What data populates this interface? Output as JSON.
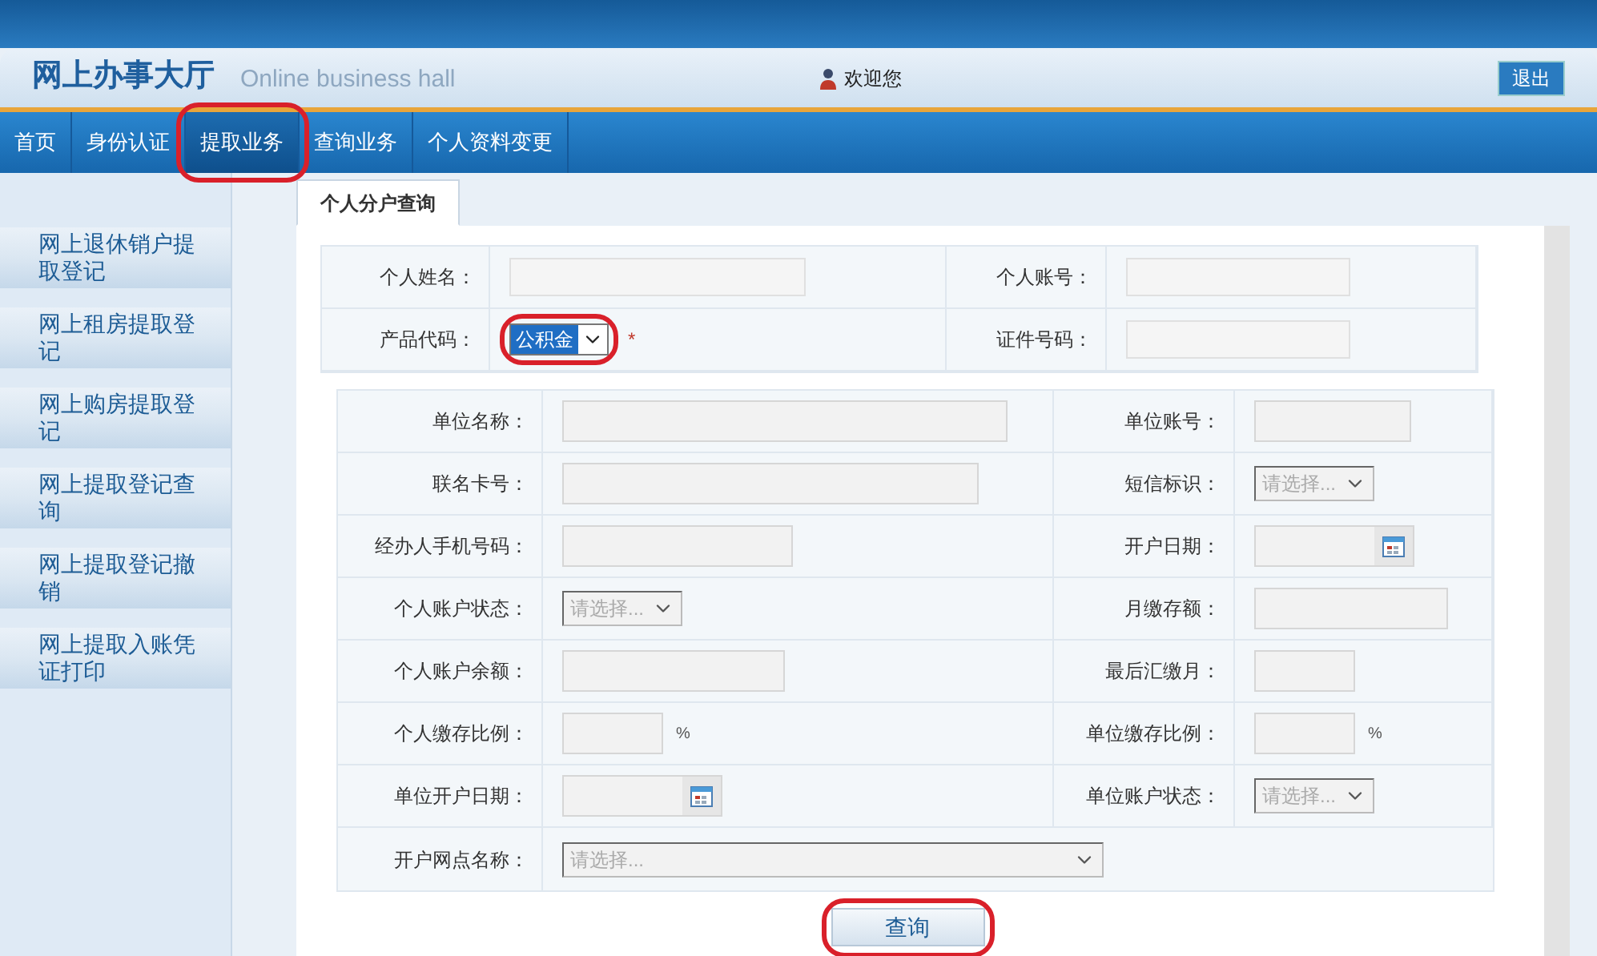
{
  "header": {
    "title": "网上办事大厅",
    "subtitle": "Online business hall",
    "welcome": "欢迎您",
    "logout": "退出"
  },
  "nav": [
    {
      "label": "首页",
      "selected": false,
      "circled": false
    },
    {
      "label": "身份认证",
      "selected": false,
      "circled": false
    },
    {
      "label": "提取业务",
      "selected": true,
      "circled": true
    },
    {
      "label": "查询业务",
      "selected": false,
      "circled": false
    },
    {
      "label": "个人资料变更",
      "selected": false,
      "circled": false
    }
  ],
  "sidebar": [
    "网上退休销户提取登记",
    "网上租房提取登记",
    "网上购房提取登记",
    "网上提取登记查询",
    "网上提取登记撤销",
    "网上提取入账凭证打印"
  ],
  "tab": {
    "label": "个人分户查询",
    "selected": true
  },
  "identity_rows": [
    [
      {
        "label": "个人姓名：",
        "kind": "text"
      },
      {
        "label": "个人账号：",
        "kind": "text"
      }
    ],
    [
      {
        "label": "产品代码：",
        "kind": "select",
        "value": "公积金",
        "required": "*",
        "circled": true
      },
      {
        "label": "证件号码：",
        "kind": "text"
      }
    ]
  ],
  "detail_rows": [
    [
      {
        "label": "单位名称：",
        "kind": "text"
      },
      {
        "label": "单位账号：",
        "kind": "text"
      }
    ],
    [
      {
        "label": "联名卡号：",
        "kind": "text"
      },
      {
        "label": "短信标识：",
        "kind": "select",
        "placeholder": "请选择..."
      }
    ],
    [
      {
        "label": "经办人手机号码：",
        "kind": "text"
      },
      {
        "label": "开户日期：",
        "kind": "date"
      }
    ],
    [
      {
        "label": "个人账户状态：",
        "kind": "select",
        "placeholder": "请选择..."
      },
      {
        "label": "月缴存额：",
        "kind": "text"
      }
    ],
    [
      {
        "label": "个人账户余额：",
        "kind": "text"
      },
      {
        "label": "最后汇缴月：",
        "kind": "text"
      }
    ],
    [
      {
        "label": "个人缴存比例：",
        "kind": "text",
        "suffix": "%"
      },
      {
        "label": "单位缴存比例：",
        "kind": "text",
        "suffix": "%"
      }
    ],
    [
      {
        "label": "单位开户日期：",
        "kind": "date"
      },
      {
        "label": "单位账户状态：",
        "kind": "select",
        "placeholder": "请选择..."
      }
    ]
  ],
  "branch": {
    "label": "开户网点名称：",
    "placeholder": "请选择..."
  },
  "query_button": {
    "label": "查询",
    "circled": true
  }
}
